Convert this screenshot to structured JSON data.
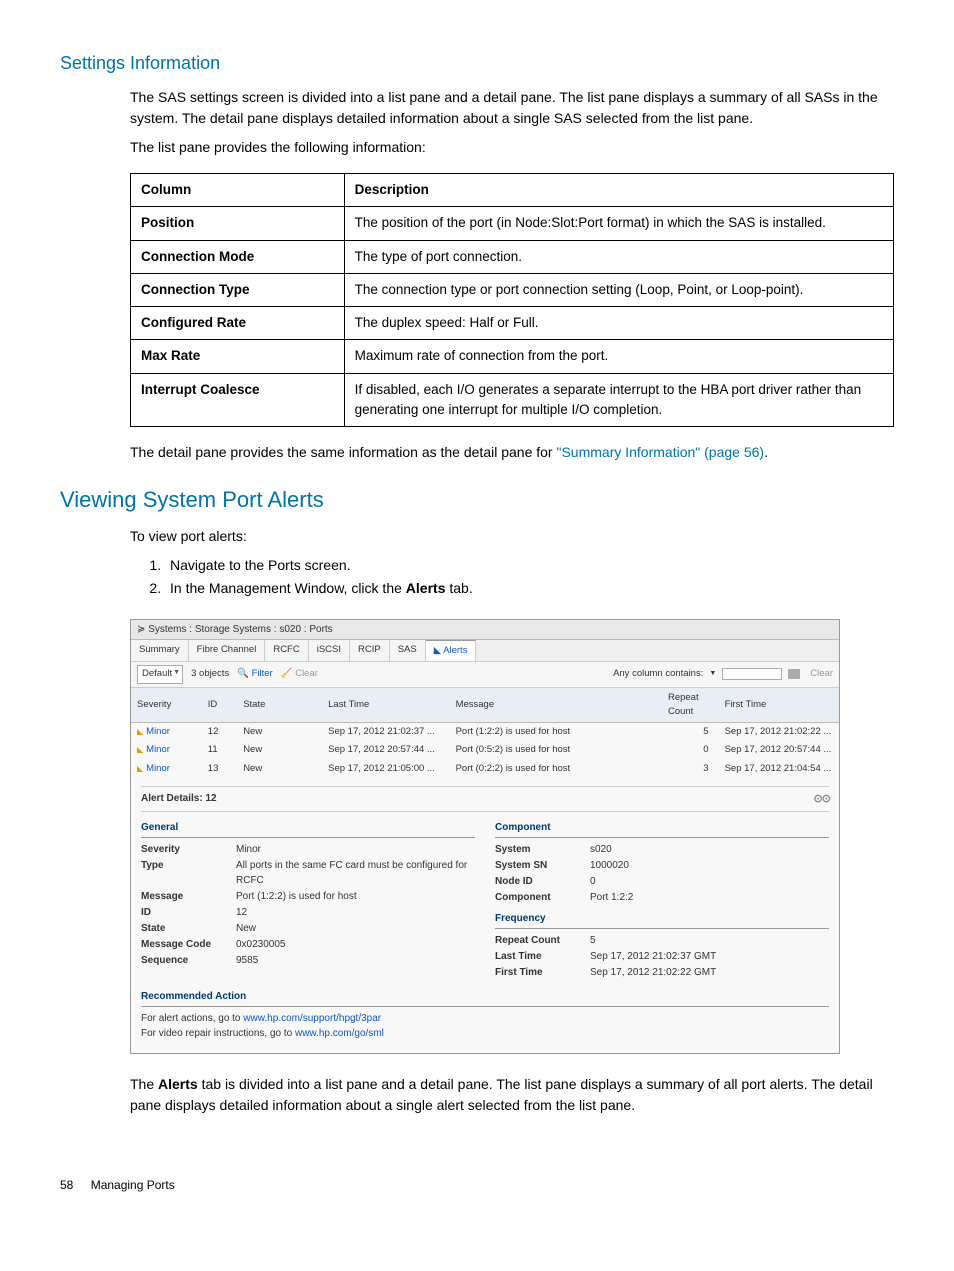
{
  "section1": {
    "title": "Settings Information",
    "p1": "The SAS settings screen is divided into a list pane and a detail pane. The list pane displays a summary of all SASs in the system. The detail pane displays detailed information about a single SAS selected from the list pane.",
    "p2": "The list pane provides the following information:",
    "table": {
      "headers": [
        "Column",
        "Description"
      ],
      "rows": [
        [
          "Position",
          "The position of the port (in Node:Slot:Port format) in which the SAS is installed."
        ],
        [
          "Connection Mode",
          "The type of port connection."
        ],
        [
          "Connection Type",
          "The connection type or port connection setting (Loop, Point, or Loop-point)."
        ],
        [
          "Configured Rate",
          "The duplex speed: Half or Full."
        ],
        [
          "Max Rate",
          "Maximum rate of connection from the port."
        ],
        [
          "Interrupt Coalesce",
          "If disabled, each I/O generates a separate interrupt to the HBA port driver rather than generating one interrupt for multiple I/O completion."
        ]
      ]
    },
    "p3_prefix": "The detail pane provides the same information as the detail pane for ",
    "p3_link": "\"Summary Information\" (page 56)",
    "p3_suffix": "."
  },
  "section2": {
    "title": "Viewing System Port Alerts",
    "intro": "To view port alerts:",
    "steps": [
      "Navigate to the Ports screen.",
      {
        "prefix": "In the Management Window, click the ",
        "bold": "Alerts",
        "suffix": " tab."
      }
    ],
    "p_after_prefix": "The ",
    "p_after_bold": "Alerts",
    "p_after_suffix": " tab is divided into a list pane and a detail pane. The list pane displays a summary of all port alerts. The detail pane displays detailed information about a single alert selected from the list pane."
  },
  "screenshot": {
    "breadcrumb": "Systems : Storage Systems : s020 : Ports",
    "tabs": [
      "Summary",
      "Fibre Channel",
      "RCFC",
      "iSCSI",
      "RCIP",
      "SAS",
      "Alerts"
    ],
    "active_tab": "Alerts",
    "toolbar": {
      "default": "Default",
      "objects": "3 objects",
      "filter": "Filter",
      "clear": "Clear",
      "any_column": "Any column contains:",
      "clear2": "Clear"
    },
    "columns": [
      "Severity",
      "ID",
      "State",
      "Last Time",
      "Message",
      "Repeat Count",
      "First Time"
    ],
    "rows": [
      {
        "sev": "Minor",
        "id": "12",
        "state": "New",
        "last": "Sep 17, 2012 21:02:37 ...",
        "msg": "Port (1:2:2) is used for host",
        "rc": "5",
        "first": "Sep 17, 2012 21:02:22 ..."
      },
      {
        "sev": "Minor",
        "id": "11",
        "state": "New",
        "last": "Sep 17, 2012 20:57:44 ...",
        "msg": "Port (0:5:2) is used for host",
        "rc": "0",
        "first": "Sep 17, 2012 20:57:44 ..."
      },
      {
        "sev": "Minor",
        "id": "13",
        "state": "New",
        "last": "Sep 17, 2012 21:05:00 ...",
        "msg": "Port (0:2:2) is used for host",
        "rc": "3",
        "first": "Sep 17, 2012 21:04:54 ..."
      }
    ],
    "details_title": "Alert Details: 12",
    "general": {
      "heading": "General",
      "items": [
        {
          "k": "Severity",
          "v": "Minor"
        },
        {
          "k": "Type",
          "v": "All ports in the same FC card must be configured for RCFC"
        },
        {
          "k": "Message",
          "v": "Port (1:2:2) is used for host"
        },
        {
          "k": "ID",
          "v": "12"
        },
        {
          "k": "State",
          "v": "New"
        },
        {
          "k": "Message Code",
          "v": "0x0230005"
        },
        {
          "k": "Sequence",
          "v": "9585"
        }
      ]
    },
    "component": {
      "heading": "Component",
      "items": [
        {
          "k": "System",
          "v": "s020"
        },
        {
          "k": "System SN",
          "v": "1000020"
        },
        {
          "k": "Node ID",
          "v": "0"
        },
        {
          "k": "Component",
          "v": "Port 1:2:2"
        }
      ]
    },
    "frequency": {
      "heading": "Frequency",
      "items": [
        {
          "k": "Repeat Count",
          "v": "5"
        },
        {
          "k": "Last Time",
          "v": "Sep 17, 2012 21:02:37 GMT"
        },
        {
          "k": "First Time",
          "v": "Sep 17, 2012 21:02:22 GMT"
        }
      ]
    },
    "recommended": {
      "heading": "Recommended Action",
      "l1_prefix": "For alert actions, go to ",
      "l1_url": "www.hp.com/support/hpgt/3par",
      "l2_prefix": "For video repair instructions, go to ",
      "l2_url": "www.hp.com/go/sml"
    }
  },
  "footer": {
    "page": "58",
    "label": "Managing Ports"
  }
}
